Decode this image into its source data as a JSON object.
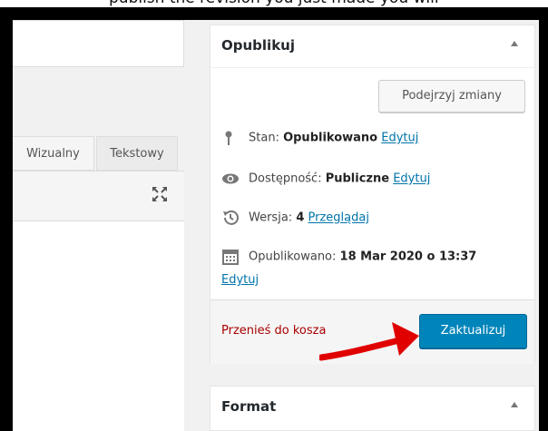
{
  "top_strip_text": "publish the revision you just made you will",
  "editor": {
    "tabs": [
      {
        "label": "Wizualny"
      },
      {
        "label": "Tekstowy"
      }
    ]
  },
  "publish_box": {
    "title": "Opublikuj",
    "preview_label": "Podejrzyj zmiany",
    "status_label": "Stan:",
    "status_value": "Opublikowano",
    "status_edit": "Edytuj",
    "visibility_label": "Dostępność:",
    "visibility_value": "Publiczne",
    "visibility_edit": "Edytuj",
    "revisions_label": "Wersja:",
    "revisions_value": "4",
    "revisions_link": "Przeglądaj",
    "published_label": "Opublikowano:",
    "published_value": "18 Mar 2020 o 13:37",
    "published_edit": "Edytuj",
    "trash_label": "Przenieś do kosza",
    "update_label": "Zaktualizuj"
  },
  "format_box": {
    "title": "Format"
  },
  "colors": {
    "primary_button": "#0085ba",
    "link": "#0073aa",
    "trash": "#a00",
    "annotation_arrow": "#e00000"
  },
  "icons": [
    "pin-icon",
    "eye-icon",
    "history-icon",
    "calendar-icon",
    "fullscreen-icon",
    "collapse-arrow-icon"
  ]
}
